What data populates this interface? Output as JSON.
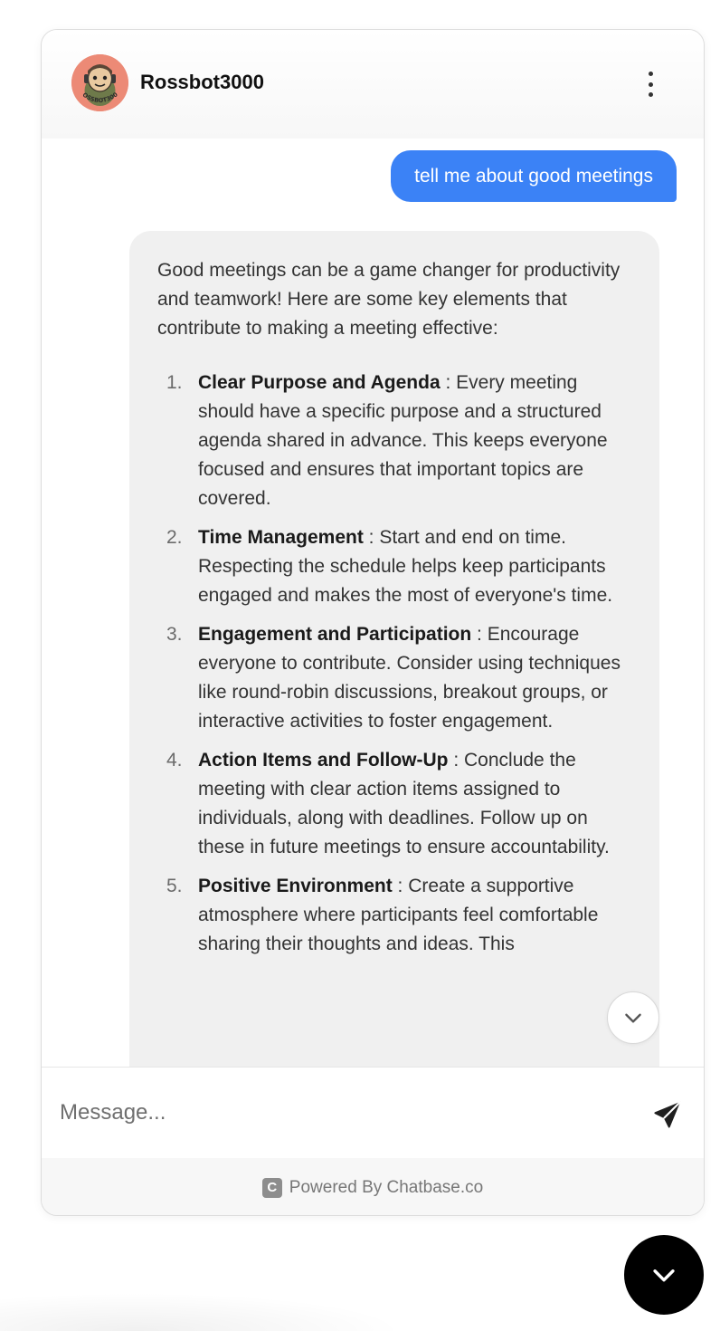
{
  "header": {
    "bot_name": "Rossbot3000",
    "avatar_text": "ROSSBOT3000",
    "menu_icon": "more-vertical-icon"
  },
  "messages": {
    "user_text": "tell me about good meetings",
    "bot_intro": "Good meetings can be a game changer for productivity and teamwork! Here are some key elements that contribute to making a meeting effective:",
    "bot_items": [
      {
        "num": "1.",
        "title": "Clear Purpose and Agenda",
        "text": " : Every meeting should have a specific purpose and a structured agenda shared in advance. This keeps everyone focused and ensures that important topics are covered."
      },
      {
        "num": "2.",
        "title": "Time Management",
        "text": " : Start and end on time. Respecting the schedule helps keep participants engaged and makes the most of everyone's time."
      },
      {
        "num": "3.",
        "title": "Engagement and Participation",
        "text": " : Encourage everyone to contribute. Consider using techniques like round-robin discussions, breakout groups, or interactive activities to foster engagement."
      },
      {
        "num": "4.",
        "title": "Action Items and Follow-Up",
        "text": " : Conclude the meeting with clear action items assigned to individuals, along with deadlines. Follow up on these in future meetings to ensure accountability."
      },
      {
        "num": "5.",
        "title": "Positive Environment",
        "text": " : Create a supportive atmosphere where participants feel comfortable sharing their thoughts and ideas. This"
      }
    ]
  },
  "input": {
    "placeholder": "Message..."
  },
  "footer": {
    "logo_letter": "C",
    "powered_by": "Powered By Chatbase.co"
  },
  "colors": {
    "user_bubble": "#3b82f6",
    "bot_bubble": "#f0f0f0",
    "launcher": "#000000",
    "avatar_bg": "#ec8a76"
  }
}
